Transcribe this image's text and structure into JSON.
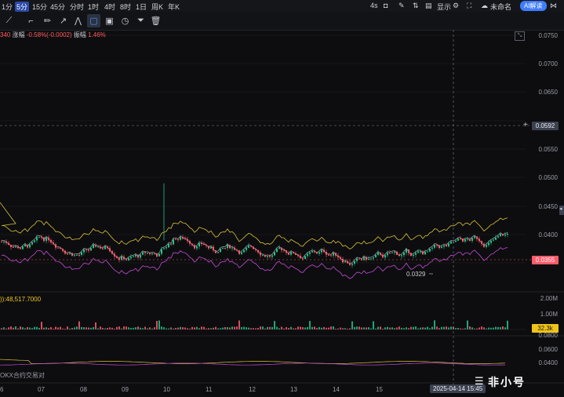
{
  "timeframes": [
    "1分",
    "5分",
    "15分",
    "45分",
    "分时",
    "1时",
    "4时",
    "8时",
    "1日",
    "周K",
    "年K"
  ],
  "active_timeframe": 1,
  "right_toolbar": {
    "interval": "4s",
    "display": "显示",
    "chart_name": "未命名",
    "ai_label": "AI解读"
  },
  "ohlc_info": {
    "prefix": "340",
    "change_label": "涨幅",
    "change_value": "-0.58%(-0.0002)",
    "amp_label": "振幅",
    "amp_value": "1.46%"
  },
  "price_axis": [
    "0.0750",
    "0.0700",
    "0.0650",
    "0.0600",
    "0.0550",
    "0.0500",
    "0.0450",
    "0.0400",
    "0.0350"
  ],
  "crosshair_price": "0.0592",
  "current_price": "0.0355",
  "low_label": "0.0329",
  "volume": {
    "label": ")):48,517.7000",
    "axis": [
      "2.00M",
      "1.00M"
    ],
    "current": "32.3k"
  },
  "sub_axis": [
    "0.0800",
    "0.0600",
    "0.0400"
  ],
  "sub_label": "OKX合约交易对",
  "x_axis": [
    "6",
    "07",
    "08",
    "09",
    "10",
    "11",
    "12",
    "13",
    "14",
    "15"
  ],
  "crosshair_date": "2025-04-14 15:45",
  "watermark": "非小号",
  "colors": {
    "up": "#23c28a",
    "down": "#ff5b6b",
    "upper_band": "#d8c13a",
    "lower_band": "#c34bd6",
    "mid_band": "#c9ccd2"
  }
}
